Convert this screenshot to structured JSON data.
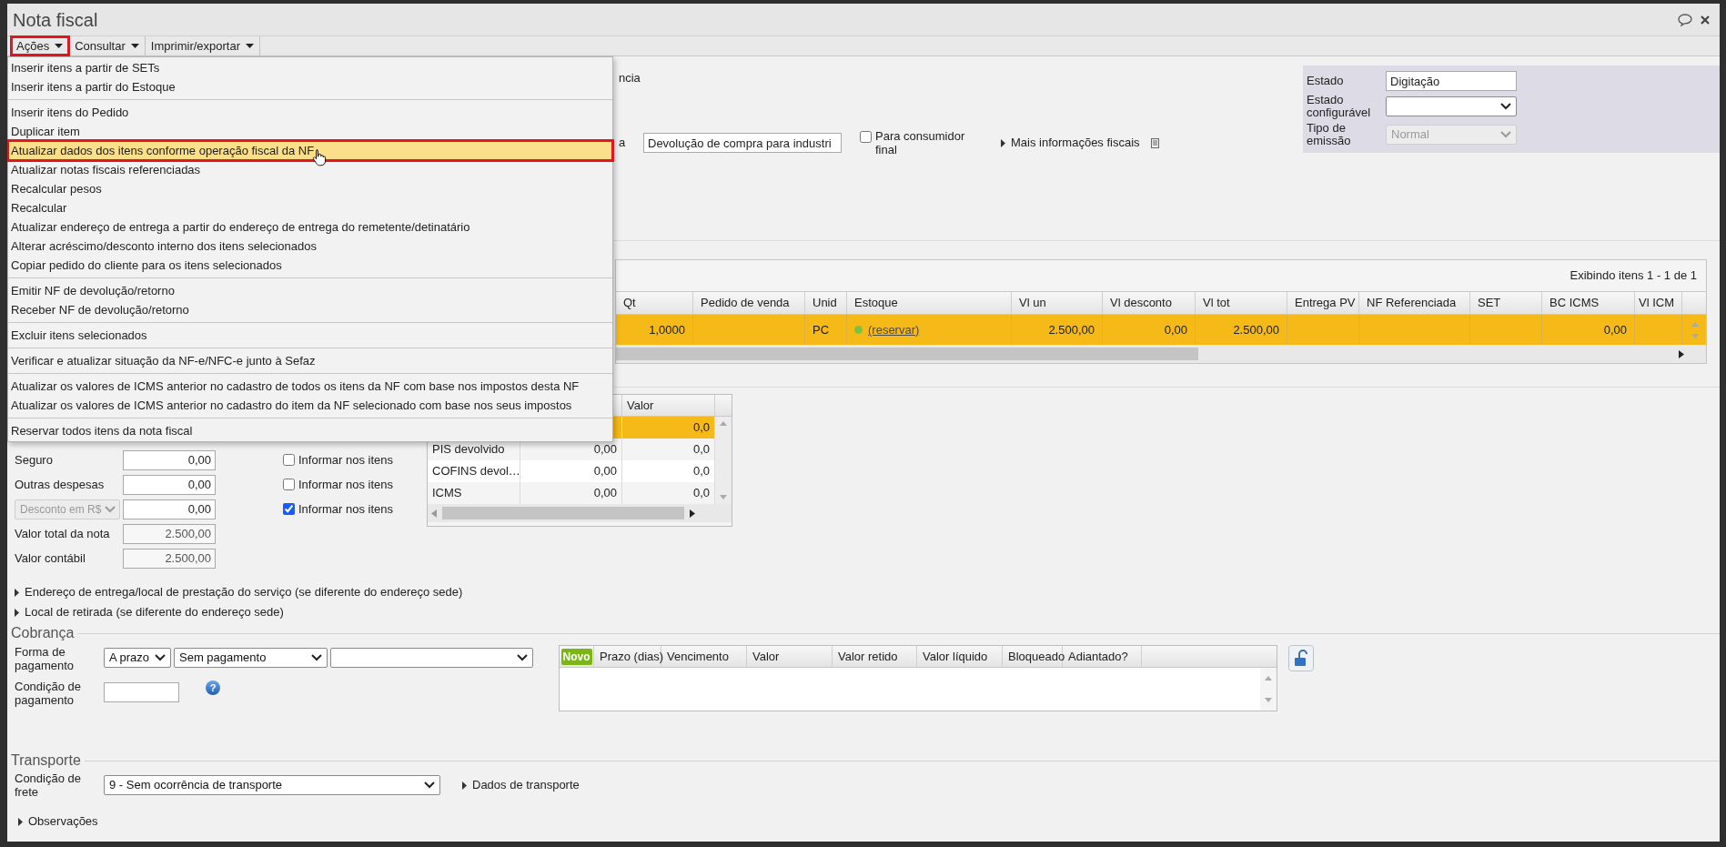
{
  "window": {
    "title": "Nota fiscal"
  },
  "toolbar": [
    {
      "label": "Ações",
      "outlined": true
    },
    {
      "label": "Consultar",
      "outlined": false
    },
    {
      "label": "Imprimir/exportar",
      "outlined": false
    }
  ],
  "menu": {
    "groups": [
      [
        {
          "label": "Inserir itens a partir de SETs",
          "selected": false,
          "outlined": false
        },
        {
          "label": "Inserir itens a partir do Estoque",
          "selected": false,
          "outlined": false
        }
      ],
      [
        {
          "label": "Inserir itens do Pedido",
          "selected": false,
          "outlined": false
        },
        {
          "label": "Duplicar item",
          "selected": false,
          "outlined": false
        },
        {
          "label": "Atualizar dados dos itens conforme operação fiscal da NF",
          "selected": true,
          "outlined": true
        },
        {
          "label": "Atualizar notas fiscais referenciadas",
          "selected": false,
          "outlined": false
        },
        {
          "label": "Recalcular pesos",
          "selected": false,
          "outlined": false
        },
        {
          "label": "Recalcular",
          "selected": false,
          "outlined": false
        },
        {
          "label": "Atualizar endereço de entrega a partir do endereço de entrega do remetente/detinatário",
          "selected": false,
          "outlined": false
        },
        {
          "label": "Alterar acréscimo/desconto interno dos itens selecionados",
          "selected": false,
          "outlined": false
        },
        {
          "label": "Copiar pedido do cliente para os itens selecionados",
          "selected": false,
          "outlined": false
        }
      ],
      [
        {
          "label": "Emitir NF de devolução/retorno",
          "selected": false,
          "outlined": false
        },
        {
          "label": "Receber NF de devolução/retorno",
          "selected": false,
          "outlined": false
        }
      ],
      [
        {
          "label": "Excluir itens selecionados",
          "selected": false,
          "outlined": false
        }
      ],
      [
        {
          "label": "Verificar e atualizar situação da NF-e/NFC-e junto à Sefaz",
          "selected": false,
          "outlined": false
        }
      ],
      [
        {
          "label": "Atualizar os valores de ICMS anterior no cadastro de todos os itens da NF com base nos impostos desta NF",
          "selected": false,
          "outlined": false
        },
        {
          "label": "Atualizar os valores de ICMS anterior no cadastro do item da NF selecionado com base nos seus impostos",
          "selected": false,
          "outlined": false
        }
      ],
      [
        {
          "label": "Reservar todos itens da nota fiscal",
          "selected": false,
          "outlined": false
        }
      ]
    ]
  },
  "header": {
    "partial_texts": [
      "ncia",
      "a"
    ],
    "operation": "Devolução de compra para industri",
    "final_consumer": {
      "label": "Para consumidor final",
      "checked": false
    },
    "fiscal_info": {
      "label": "Mais informações fiscais",
      "expanded": false
    }
  },
  "status_panel": [
    {
      "label": "Estado",
      "kind": "text",
      "value": "Digitação",
      "disabled": false
    },
    {
      "label": "Estado configurável",
      "kind": "select",
      "disabled": false
    },
    {
      "label": "Tipo de emissão",
      "kind": "select",
      "value": "Normal",
      "disabled": true
    }
  ],
  "items_table": {
    "summary": "Exibindo itens 1 - 1 de 1",
    "columns": [
      {
        "label": "Qt",
        "kind": "number"
      },
      {
        "label": "Pedido de venda",
        "kind": "text"
      },
      {
        "label": "Unid",
        "kind": "text"
      },
      {
        "label": "Estoque",
        "kind": "stock"
      },
      {
        "label": "Vl un",
        "kind": "number"
      },
      {
        "label": "Vl desconto",
        "kind": "number"
      },
      {
        "label": "Vl tot",
        "kind": "number"
      },
      {
        "label": "Entrega PV",
        "kind": "text"
      },
      {
        "label": "NF Referenciada",
        "kind": "text"
      },
      {
        "label": "SET",
        "kind": "text"
      },
      {
        "label": "BC ICMS",
        "kind": "number"
      },
      {
        "label": "Vl ICM",
        "kind": "number"
      }
    ],
    "rows": [
      {
        "selected": true,
        "cells": [
          "1,0000",
          null,
          "PC",
          "(reservar)",
          "2.500,00",
          "0,00",
          "2.500,00",
          null,
          null,
          null,
          "0,00",
          null
        ]
      }
    ]
  },
  "totals": [
    {
      "label": "Seguro",
      "kind": "text",
      "value": "0,00",
      "disabled": false
    },
    {
      "label": "Outras despesas",
      "kind": "text",
      "value": "0,00",
      "disabled": false
    },
    {
      "label": "Desconto em R$",
      "kind": "select",
      "value": "0,00",
      "disabled": true
    },
    {
      "label": "Valor total da nota",
      "kind": "text",
      "value": "2.500,00",
      "disabled": true
    },
    {
      "label": "Valor contábil",
      "kind": "text",
      "value": "2.500,00",
      "disabled": true
    }
  ],
  "item_checkboxes": [
    {
      "label": "Informar nos itens",
      "checked": false
    },
    {
      "label": "Informar nos itens",
      "checked": false
    },
    {
      "label": "Informar nos itens",
      "checked": true
    }
  ],
  "tax_table": {
    "header": {
      "column_3": "Valor"
    },
    "rows": [
      {
        "selected": true,
        "cells": [
          null,
          null,
          "0,0"
        ]
      },
      {
        "selected": false,
        "cells": [
          "PIS devolvido",
          "0,00",
          "0,0"
        ]
      },
      {
        "selected": false,
        "cells": [
          "COFINS devol…",
          "0,00",
          "0,0"
        ]
      },
      {
        "selected": false,
        "cells": [
          "ICMS",
          "0,00",
          "0,0"
        ]
      }
    ]
  },
  "expanders": [
    {
      "label": "Endereço de entrega/local de prestação do serviço (se diferente do endereço sede)",
      "expanded": false
    },
    {
      "label": "Local de retirada (se diferente do endereço sede)",
      "expanded": false
    }
  ],
  "cobranca": {
    "legend": "Cobrança",
    "payment_label": "Forma de pagamento",
    "payment_selects": [
      "A prazo",
      "Sem pagamento"
    ],
    "condition_label": "Condição de pagamento",
    "help": "?",
    "grid": {
      "new_button": "Novo",
      "columns": [
        "Prazo (dias)",
        "Vencimento",
        "Valor",
        "Valor retido",
        "Valor líquido",
        "Bloqueado",
        "Adiantado?"
      ]
    }
  },
  "transporte": {
    "legend": "Transporte",
    "freight_label": "Condição de frete",
    "freight_value": "9 - Sem ocorrência de transporte",
    "details": {
      "label": "Dados de transporte",
      "expanded": false
    }
  },
  "observacoes": {
    "label": "Observações",
    "expanded": false
  }
}
